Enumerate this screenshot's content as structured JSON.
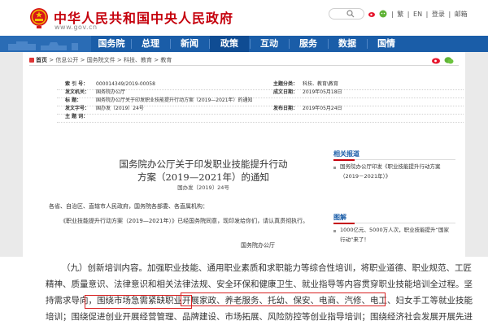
{
  "header": {
    "site_title": "中华人民共和国中央人民政府",
    "site_url": "www.gov.cn",
    "lang_links": [
      "繁",
      "EN",
      "登录",
      "邮箱"
    ],
    "lang_sep": "|"
  },
  "nav": {
    "items": [
      "国务院",
      "总理",
      "新闻",
      "政策",
      "互动",
      "服务",
      "数据",
      "国情"
    ],
    "active_index": 3
  },
  "breadcrumb": {
    "home": "首页",
    "path": [
      "信息公开",
      "国务院文件",
      "科技、教育",
      "教育"
    ],
    "sep": ">"
  },
  "meta": {
    "index_label": "索  引  号：",
    "index_value": "000014349/2019-00058",
    "topic_label": "主题分类：",
    "topic_value": "科技、教育\\教育",
    "issuer_label": "发文机关：",
    "issuer_value": "国务院办公厅",
    "written_label": "成文日期：",
    "written_value": "2019年05月18日",
    "title_label": "标      题：",
    "title_value": "国务院办公厅关于印发职业技能提升行动方案（2019—2021年）的通知",
    "docnum_label": "发文字号：",
    "docnum_value": "国办发〔2019〕24号",
    "publish_label": "发布日期：",
    "publish_value": "2019年05月24日",
    "keywords_label": "主  题  词："
  },
  "article": {
    "title_line1": "国务院办公厅关于印发职业技能提升行动",
    "title_line2": "方案（2019—2021年）的通知",
    "doc_number": "国办发〔2019〕24号",
    "salutation": "各省、自治区、直辖市人民政府，国务院各部委、各直属机构：",
    "body": "《职业技能提升行动方案（2019—2021年）》已经国务院同意，现印发给你们，请认真贯彻执行。",
    "signature": "国务院办公厅"
  },
  "sidebar": {
    "news_title": "相关报道",
    "news_link": "国务院办公厅印发《职业技能提升行动方案（2019－2021年）》",
    "graphic_title": "图解",
    "graphic_link": "1000亿元、5000万人次，职业技能提升“国家行动”来了！"
  },
  "zoom": {
    "line1": "（九）创新培训内容。加强职业技能、通用职业素质和求职能力等综合性培训，将职业道德、职业规范、工匠",
    "line2": "精神、质量意识、法律意识和相关法律法规、安全环保和健康卫生、就业指导等内容贯穿职业技能培训全过程。坚",
    "line3": "持需求导向，围绕市场急需紧缺职业开展家政、养老服务、托幼、保安、电商、汽修、电工、妇女手工等就业技能",
    "line4": "培训；围绕促进创业开展经营管理、品牌建设、市场拓展、风险防控等创业指导培训；围绕经济社会发展开展先进"
  },
  "colors": {
    "brand_red": "#c5000c",
    "nav_blue": "#1a5da8",
    "highlight_red": "#d82020"
  }
}
